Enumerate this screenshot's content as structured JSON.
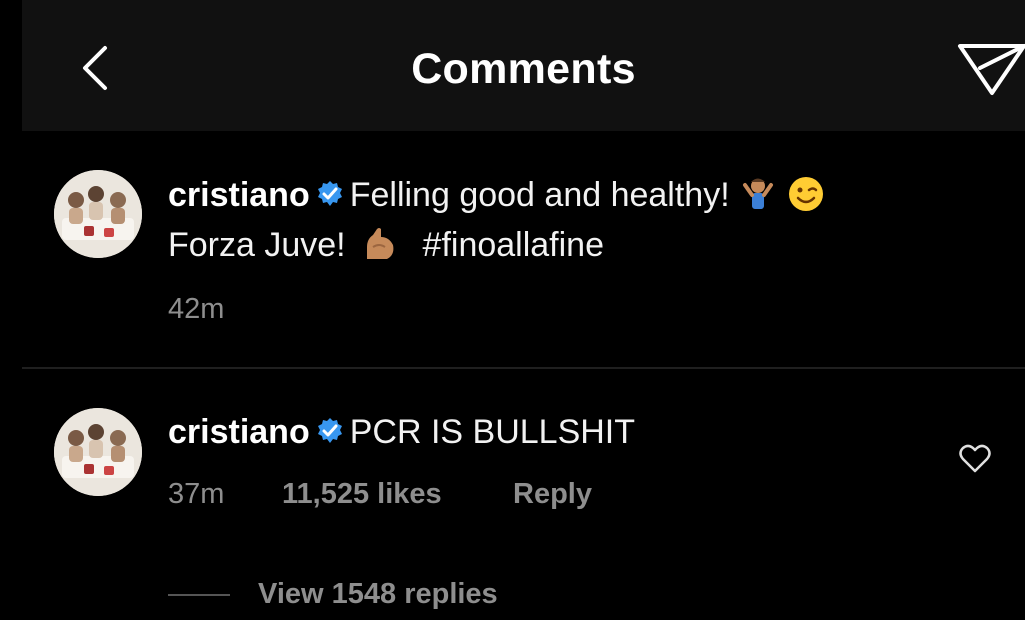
{
  "header": {
    "title": "Comments",
    "back_icon": "chevron-left-icon",
    "send_icon": "paper-plane-icon"
  },
  "caption": {
    "username": "cristiano",
    "text_part1": "Felling good and healthy!",
    "text_part2": "Forza Juve!",
    "hashtag": "#finoallafine",
    "emojis": [
      "person-shrugging-emoji",
      "winking-face-emoji",
      "flexed-biceps-emoji"
    ],
    "time": "42m"
  },
  "comment": {
    "username": "cristiano",
    "text": "PCR IS BULLSHIT",
    "time": "37m",
    "likes": "11,525 likes",
    "reply_label": "Reply",
    "view_replies": "View 1548 replies"
  },
  "colors": {
    "background": "#000000",
    "header_background": "#111111",
    "text_primary": "#f2f2f2",
    "text_secondary": "#8e8e8e",
    "verified_blue": "#3897f0"
  }
}
